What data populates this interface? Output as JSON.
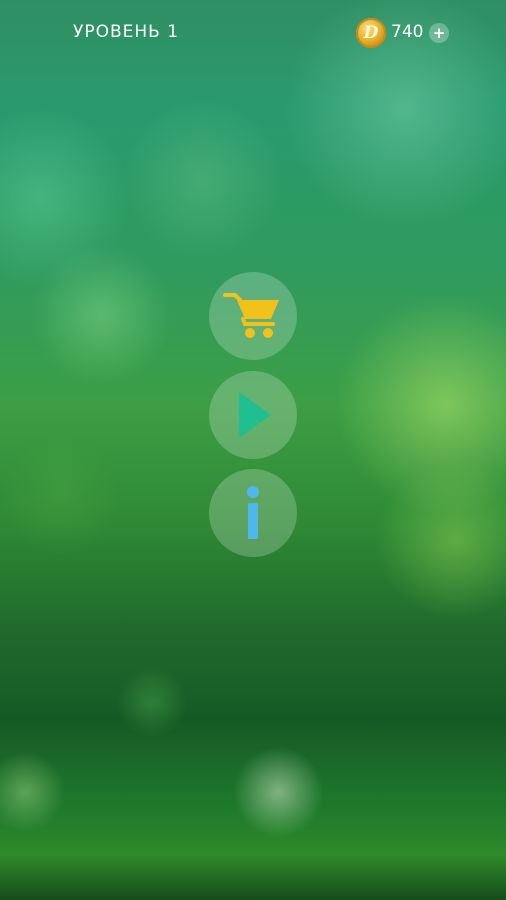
{
  "header": {
    "level_label": "УРОВЕНЬ 1",
    "coin_symbol": "D",
    "coins": "740",
    "add_coins_label": "+"
  },
  "menu": {
    "shop_icon": "shopping-cart-icon",
    "play_icon": "play-icon",
    "info_icon": "info-icon"
  },
  "colors": {
    "cart": "#f2c21b",
    "play": "#1fbf8f",
    "info": "#4fb8ea"
  }
}
